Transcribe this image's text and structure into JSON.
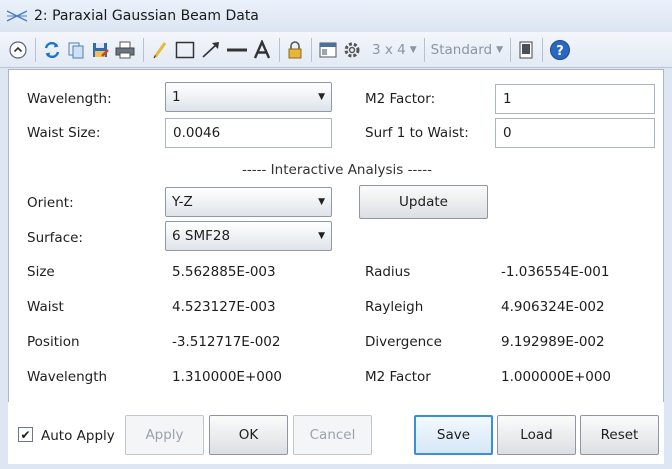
{
  "window": {
    "title": "2: Paraxial Gaussian Beam Data"
  },
  "toolbar": {
    "icons": [
      "collapse-icon",
      "refresh-icon",
      "copy-icon",
      "save-icon",
      "print-icon",
      "pencil-icon",
      "rectangle-icon",
      "arrow-icon",
      "line-icon",
      "text-icon",
      "lock-icon",
      "window-layout-icon",
      "settings-icon"
    ],
    "grid_label": "3 x 4",
    "standard_label": "Standard"
  },
  "settings": {
    "wavelength_label": "Wavelength:",
    "wavelength_value": "1",
    "m2_label": "M2 Factor:",
    "m2_value": "1",
    "waist_label": "Waist Size:",
    "waist_value": "0.0046",
    "surf_label": "Surf 1 to Waist:",
    "surf_value": "0"
  },
  "interactive": {
    "title": "----- Interactive Analysis -----",
    "orient_label": "Orient:",
    "orient_value": "Y-Z",
    "update_label": "Update",
    "surface_label": "Surface:",
    "surface_value": "6 SMF28"
  },
  "results": [
    {
      "label": "Size",
      "value": "5.562885E-003",
      "label2": "Radius",
      "value2": "-1.036554E-001"
    },
    {
      "label": "Waist",
      "value": "4.523127E-003",
      "label2": "Rayleigh",
      "value2": "4.906324E-002"
    },
    {
      "label": "Position",
      "value": "-3.512717E-002",
      "label2": "Divergence",
      "value2": "9.192989E-002"
    },
    {
      "label": "Wavelength",
      "value": "1.310000E+000",
      "label2": "M2 Factor",
      "value2": "1.000000E+000"
    }
  ],
  "footer": {
    "auto_apply_label": "Auto Apply",
    "auto_apply_checked": true,
    "apply_label": "Apply",
    "ok_label": "OK",
    "cancel_label": "Cancel",
    "save_label": "Save",
    "load_label": "Load",
    "reset_label": "Reset"
  }
}
